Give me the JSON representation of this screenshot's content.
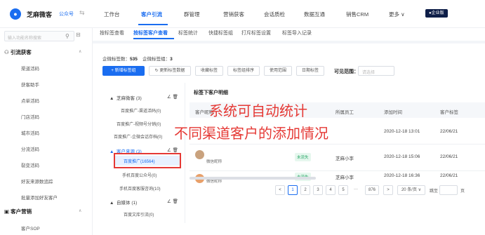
{
  "brand": {
    "name": "芝麻微客",
    "sub": "公众号",
    "toggle": "⇆"
  },
  "topnav": [
    {
      "label": "工作台"
    },
    {
      "label": "客户引流"
    },
    {
      "label": "群管理"
    },
    {
      "label": "营销获客"
    },
    {
      "label": "会话质检"
    },
    {
      "label": "数据互通"
    },
    {
      "label": "销售CRM"
    },
    {
      "label": "更多 ∨"
    }
  ],
  "enterprise_badge": "●企业版",
  "sidebar": {
    "search_placeholder": "输入功能名称搜索",
    "groups": [
      {
        "label": "引流获客",
        "items": [
          "渠道活码",
          "获客助手",
          "点单活码",
          "门店活码",
          "城市活码",
          "分流活码",
          "裂变活码",
          "好友来源数追踪",
          "批量添加好友客户"
        ]
      },
      {
        "label": "客户营销",
        "items": [
          "客户SOP"
        ]
      }
    ]
  },
  "subtabs": [
    "按标签查看",
    "按标签客户查看",
    "标签统计",
    "快捷标签组",
    "打斥标签设置",
    "标签导入记录"
  ],
  "stats": {
    "label_total": "企微标签数：",
    "total": "535",
    "label_groups": "企微标签组：",
    "groups": "3"
  },
  "toolbar": {
    "new_group": "+ 新增标签组",
    "update_data": "↻ 更新标签数据",
    "collect": "收藏标签",
    "sort": "标签组排序",
    "range": "使用范围",
    "log": "日期标签",
    "visible_label": "可见范围：",
    "visible_placeholder": "请选择"
  },
  "tree": {
    "groups": [
      {
        "label": "芝麻微客 (3)",
        "items": [
          "百度推广-渠道活码(0)",
          "百度推广-视频号分销(0)",
          "百度推广-企微会话存档(0)"
        ]
      },
      {
        "label": "客户来源 (3)",
        "items": [
          "百度推广(16564)",
          "手机百度公众号(0)",
          "手机百度客服咨询(10)"
        ]
      },
      {
        "label": "自媒体 (1)",
        "items": [
          "百度文库引流(0)"
        ]
      }
    ],
    "ops": "∠ 🗑"
  },
  "table": {
    "title": "标签下客户明细",
    "headers": [
      "客户昵称",
      "所属员工",
      "添加时间",
      "客户标签"
    ],
    "rows": [
      {
        "nick": "",
        "tag": "",
        "staff": "",
        "time": "2020-12-18 13:01",
        "tags": "22/06/21"
      },
      {
        "nick": "微信昵称",
        "tag": "未流失",
        "staff": "芝麻小李",
        "time": "2020-12-18 15:06",
        "tags": "22/06/21"
      },
      {
        "nick": "微信昵称",
        "tag": "未流失",
        "staff": "芝麻小李",
        "time": "2020-12-18 16:36",
        "tags": "22/06/21"
      }
    ]
  },
  "overlay": {
    "line1": "系统可自动统计",
    "line2": "不同渠道客户的添加情况"
  },
  "pagination": {
    "prev": "<",
    "pages": [
      "1",
      "2",
      "3",
      "4",
      "5",
      "···",
      "876"
    ],
    "next": ">",
    "per_page": "20 条/页 ∨",
    "goto": "跳至",
    "page_unit": "页"
  },
  "colors": {
    "accent": "#1a6df0",
    "annotation": "#e53935"
  }
}
